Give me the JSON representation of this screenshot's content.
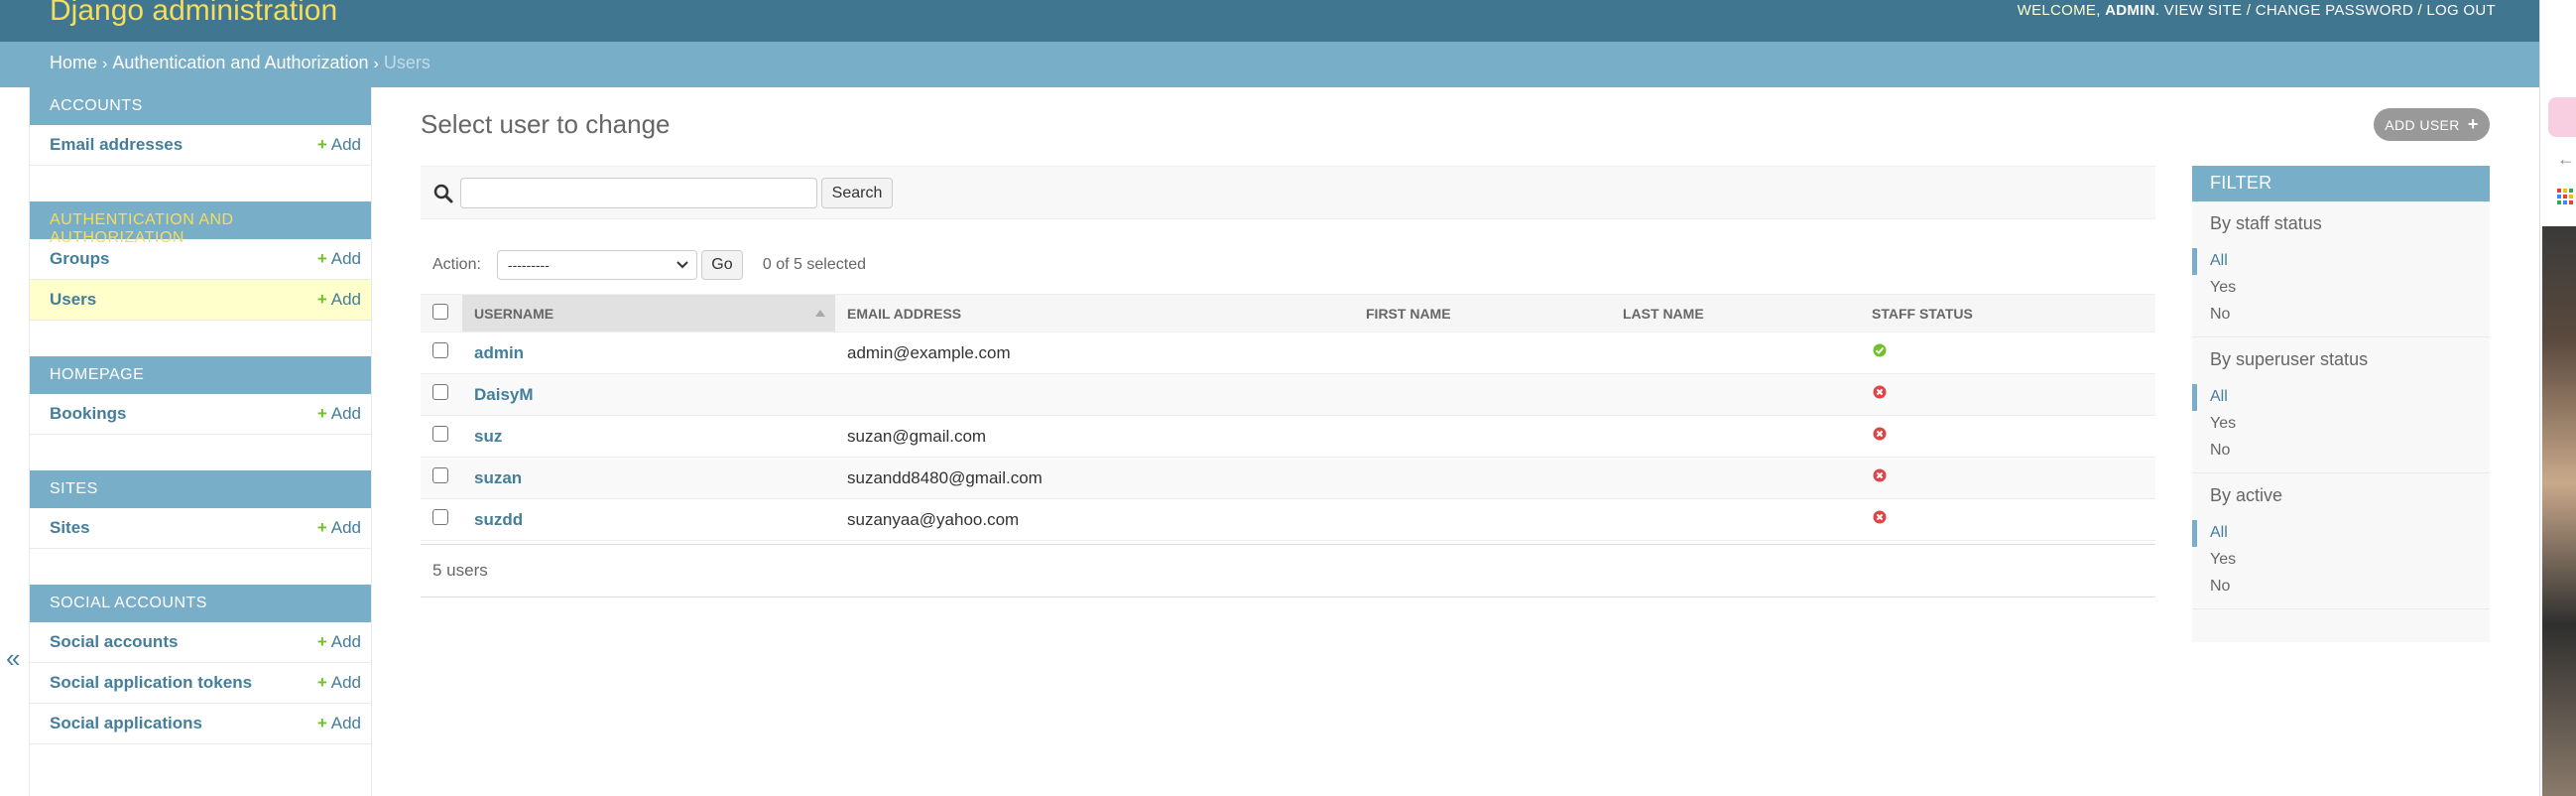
{
  "header": {
    "brand": "Django administration",
    "welcome": "Welcome,",
    "username": "admin",
    "view_site": "View site",
    "change_password": "Change password",
    "log_out": "Log out"
  },
  "breadcrumbs": {
    "home": "Home",
    "section": "Authentication and Authorization",
    "current": "Users"
  },
  "sidebar": {
    "add_label": "Add",
    "collapse_icon": "«",
    "modules": [
      {
        "caption": "Accounts",
        "items": [
          {
            "label": "Email addresses"
          }
        ]
      },
      {
        "caption": "Authentication and Authorization",
        "items": [
          {
            "label": "Groups"
          },
          {
            "label": "Users"
          }
        ]
      },
      {
        "caption": "Homepage",
        "items": [
          {
            "label": "Bookings"
          }
        ]
      },
      {
        "caption": "Sites",
        "items": [
          {
            "label": "Sites"
          }
        ]
      },
      {
        "caption": "Social Accounts",
        "items": [
          {
            "label": "Social accounts"
          },
          {
            "label": "Social application tokens"
          },
          {
            "label": "Social applications"
          }
        ]
      }
    ]
  },
  "main": {
    "title": "Select user to change",
    "add_button": "Add user",
    "search": {
      "placeholder": "",
      "value": "",
      "button": "Search"
    },
    "actions": {
      "label": "Action:",
      "selected": "---------",
      "go": "Go",
      "counter": "0 of 5 selected"
    },
    "table": {
      "columns": [
        "Username",
        "Email address",
        "First name",
        "Last name",
        "Staff status"
      ],
      "rows": [
        {
          "username": "admin",
          "email": "admin@example.com",
          "first_name": "",
          "last_name": "",
          "staff": true
        },
        {
          "username": "DaisyM",
          "email": "",
          "first_name": "",
          "last_name": "",
          "staff": false
        },
        {
          "username": "suz",
          "email": "suzan@gmail.com",
          "first_name": "",
          "last_name": "",
          "staff": false
        },
        {
          "username": "suzan",
          "email": "suzandd8480@gmail.com",
          "first_name": "",
          "last_name": "",
          "staff": false
        },
        {
          "username": "suzdd",
          "email": "suzanyaa@yahoo.com",
          "first_name": "",
          "last_name": "",
          "staff": false
        }
      ]
    },
    "paginator": "5 users"
  },
  "filter": {
    "title": "Filter",
    "groups": [
      {
        "heading": "By staff status",
        "options": [
          "All",
          "Yes",
          "No"
        ]
      },
      {
        "heading": "By superuser status",
        "options": [
          "All",
          "Yes",
          "No"
        ]
      },
      {
        "heading": "By active",
        "options": [
          "All",
          "Yes",
          "No"
        ]
      }
    ]
  },
  "colors": {
    "header_bg": "#417690",
    "breadcrumb_bg": "#79aec8",
    "brand_yellow": "#f5dd5d",
    "link": "#447e9b",
    "add_green": "#70bf2b",
    "yes_green": "#70bf2b",
    "no_red": "#dd4646"
  }
}
